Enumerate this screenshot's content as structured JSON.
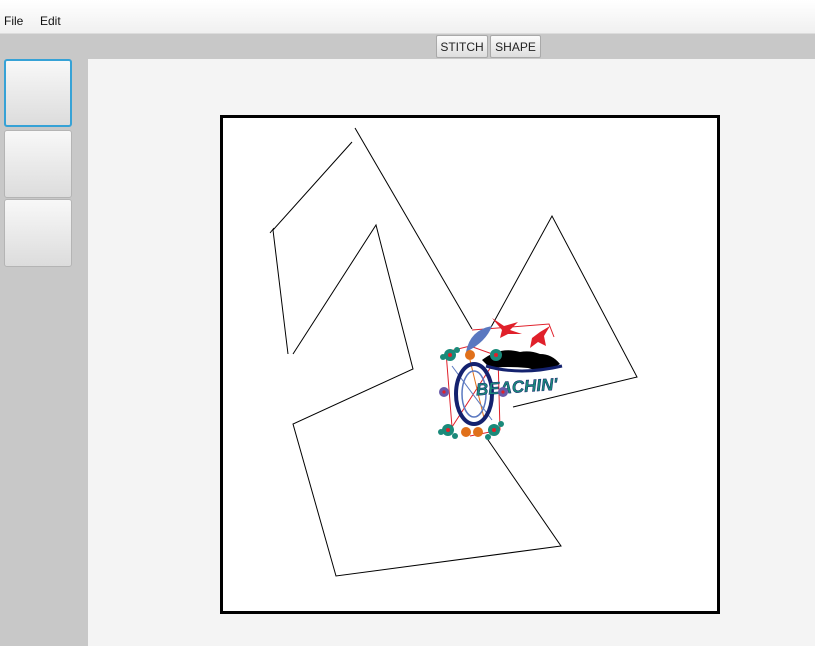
{
  "menubar": {
    "file": "File",
    "edit": "Edit"
  },
  "toolbar": {
    "stitch": "STITCH",
    "shape": "SHAPE"
  },
  "sidebar": {
    "thumbnails": [
      {
        "selected": true
      },
      {
        "selected": false
      },
      {
        "selected": false
      }
    ]
  },
  "canvas": {
    "design_text": "BEACHIN'",
    "colors": {
      "stroke": "#000000",
      "teal": "#1a8a7a",
      "navy": "#14226e",
      "red": "#e0202a",
      "orange": "#e0701a",
      "blue": "#5a78c0",
      "purple": "#6a5aa8"
    }
  }
}
